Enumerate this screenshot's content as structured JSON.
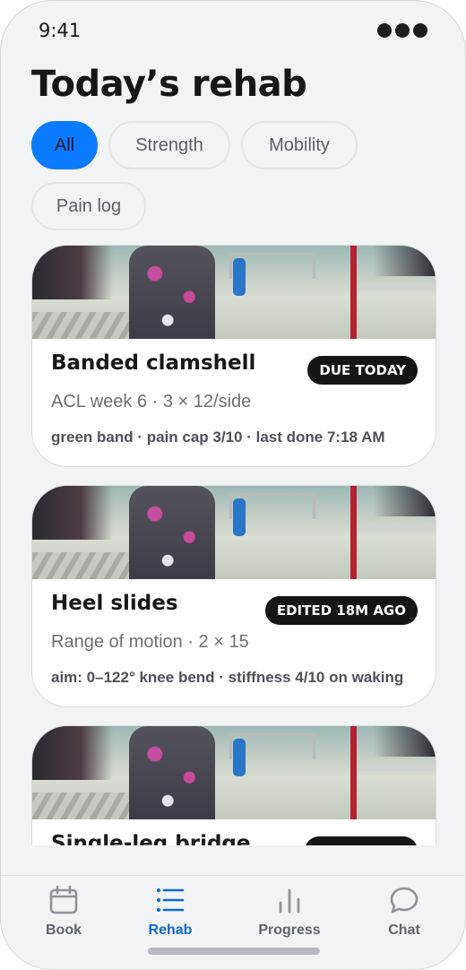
{
  "status_bar": {
    "time": "9:41"
  },
  "header": {
    "title": "Today’s rehab"
  },
  "filters": [
    {
      "label": "All",
      "selected": true
    },
    {
      "label": "Strength",
      "selected": false
    },
    {
      "label": "Mobility",
      "selected": false
    },
    {
      "label": "Pain log",
      "selected": false
    }
  ],
  "cards": [
    {
      "name": "Banded clamshell",
      "badge": "DUE TODAY",
      "subtitle": "ACL week 6 · 3 × 12/side",
      "detail": "green band · pain cap 3/10 · last done 7:18 AM"
    },
    {
      "name": "Heel slides",
      "badge": "EDITED 18M AGO",
      "subtitle": "Range of motion · 2 × 15",
      "detail": "aim: 0–122° knee bend · stiffness 4/10 on waking"
    },
    {
      "name": "Single-leg bridge",
      "badge": "",
      "subtitle": "",
      "detail": ""
    }
  ],
  "tab_bar": {
    "tabs": [
      {
        "label": "Book",
        "icon": "calendar-icon",
        "active": false
      },
      {
        "label": "Rehab",
        "icon": "list-icon",
        "active": true
      },
      {
        "label": "Progress",
        "icon": "bar-chart-icon",
        "active": false
      },
      {
        "label": "Chat",
        "icon": "chat-bubble-icon",
        "active": false
      }
    ]
  },
  "colors": {
    "accent": "#0a7bff",
    "active_tab": "#1167d6",
    "badge_bg": "#141517"
  }
}
